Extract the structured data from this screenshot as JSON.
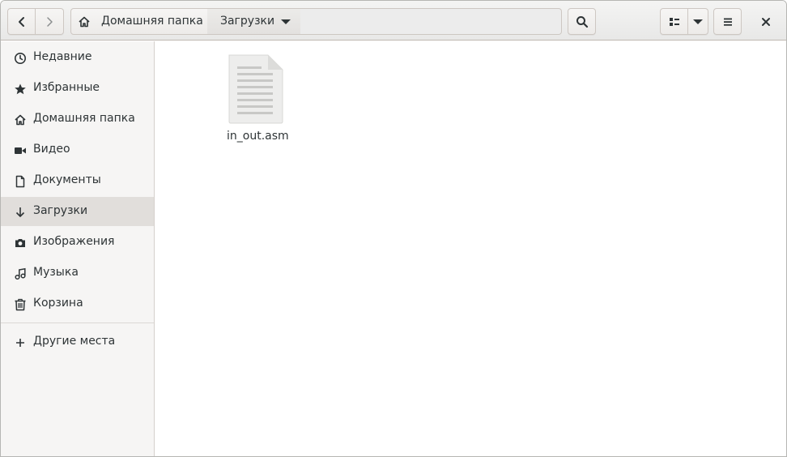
{
  "header": {
    "path": [
      "Домашняя папка",
      "Загрузки"
    ]
  },
  "sidebar": {
    "items": [
      {
        "label": "Недавние",
        "icon": "clock-icon"
      },
      {
        "label": "Избранные",
        "icon": "star-icon"
      },
      {
        "label": "Домашняя папка",
        "icon": "home-icon"
      },
      {
        "label": "Видео",
        "icon": "video-icon"
      },
      {
        "label": "Документы",
        "icon": "document-icon"
      },
      {
        "label": "Загрузки",
        "icon": "download-icon",
        "active": true
      },
      {
        "label": "Изображения",
        "icon": "camera-icon"
      },
      {
        "label": "Музыка",
        "icon": "music-icon"
      },
      {
        "label": "Корзина",
        "icon": "trash-icon"
      }
    ],
    "other_places": {
      "label": "Другие места",
      "icon": "plus-icon"
    }
  },
  "files": [
    {
      "name": "in_out.asm",
      "icon": "text-file-icon"
    }
  ],
  "colors": {
    "sidebar_bg": "#f6f5f4",
    "active_item_bg": "#e1dedb",
    "text": "#2e3436"
  }
}
